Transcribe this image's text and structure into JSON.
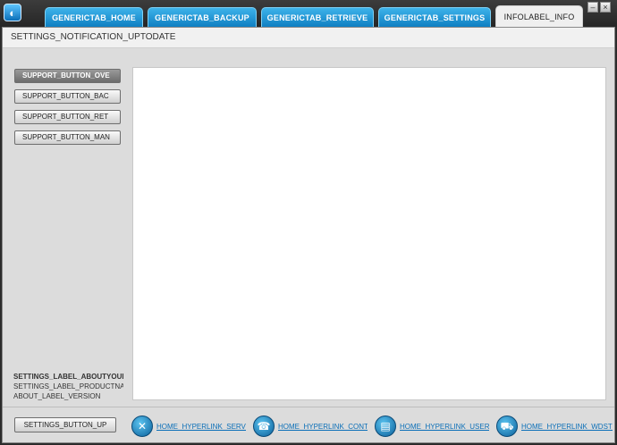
{
  "tabs": [
    {
      "label": "GENERICTAB_HOME"
    },
    {
      "label": "GENERICTAB_BACKUP"
    },
    {
      "label": "GENERICTAB_RETRIEVE"
    },
    {
      "label": "GENERICTAB_SETTINGS"
    },
    {
      "label": "INFOLABEL_INFO",
      "active": true
    }
  ],
  "window_controls": {
    "minimize": "–",
    "close": "×"
  },
  "notification": "SETTINGS_NOTIFICATION_UPTODATE",
  "sidebar": {
    "buttons": [
      {
        "label": "SUPPORT_BUTTON_OVE",
        "selected": true
      },
      {
        "label": "SUPPORT_BUTTON_BAC"
      },
      {
        "label": "SUPPORT_BUTTON_RET"
      },
      {
        "label": "SUPPORT_BUTTON_MAN"
      }
    ],
    "info": {
      "about": "SETTINGS_LABEL_ABOUTYOURS",
      "product": "SETTINGS_LABEL_PRODUCTNAM",
      "version": "ABOUT_LABEL_VERSION"
    }
  },
  "footer": {
    "update_button": "SETTINGS_BUTTON_UP",
    "links": [
      {
        "icon": "tools-icon",
        "label": "HOME_HYPERLINK_SERVICE"
      },
      {
        "icon": "phone-icon",
        "label": "HOME_HYPERLINK_CONTACT"
      },
      {
        "icon": "book-icon",
        "label": "HOME_HYPERLINK_USERMAN"
      },
      {
        "icon": "cart-icon",
        "label": "HOME_HYPERLINK_WDSTORE"
      }
    ]
  }
}
